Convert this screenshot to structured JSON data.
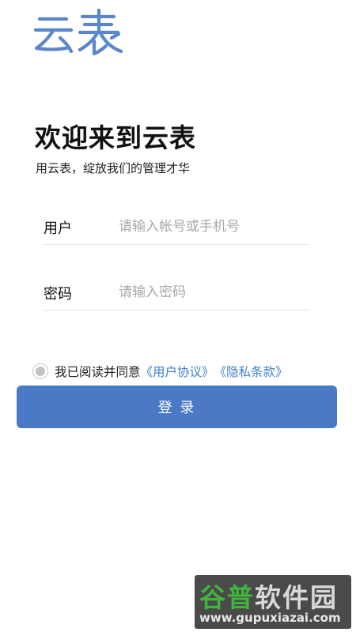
{
  "logo": {
    "text": "云表",
    "color": "#5b87c9"
  },
  "welcome": {
    "title": "欢迎来到云表",
    "subtitle": "用云表，绽放我们的管理才华"
  },
  "form": {
    "username": {
      "label": "用户",
      "placeholder": "请输入帐号或手机号",
      "value": ""
    },
    "password": {
      "label": "密码",
      "placeholder": "请输入密码",
      "value": ""
    }
  },
  "agreement": {
    "checked": false,
    "text": "我已阅读并同意",
    "user_agreement": "《用户协议》",
    "privacy_policy": "《隐私条款》",
    "link_color": "#3f7fd0"
  },
  "login_button": {
    "label": "登 录",
    "color": "#4a79c6"
  },
  "watermark": {
    "title_part1": "谷普",
    "title_part2": "软件园",
    "url": "www.gupuxiazai.com"
  }
}
